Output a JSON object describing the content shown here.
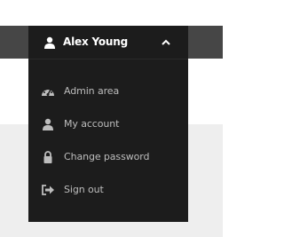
{
  "user_menu": {
    "user_name": "Alex Young",
    "items": [
      {
        "label": "Admin area",
        "icon": "dashboard-icon"
      },
      {
        "label": "My account",
        "icon": "user-icon"
      },
      {
        "label": "Change password",
        "icon": "lock-icon"
      },
      {
        "label": "Sign out",
        "icon": "sign-out-icon"
      }
    ]
  },
  "colors": {
    "topbar": "#464646",
    "dropdown_bg": "#1c1c1c",
    "content_bg": "#eeeeee",
    "menu_text": "#bdbdbd",
    "icon": "#bdbdbd"
  }
}
